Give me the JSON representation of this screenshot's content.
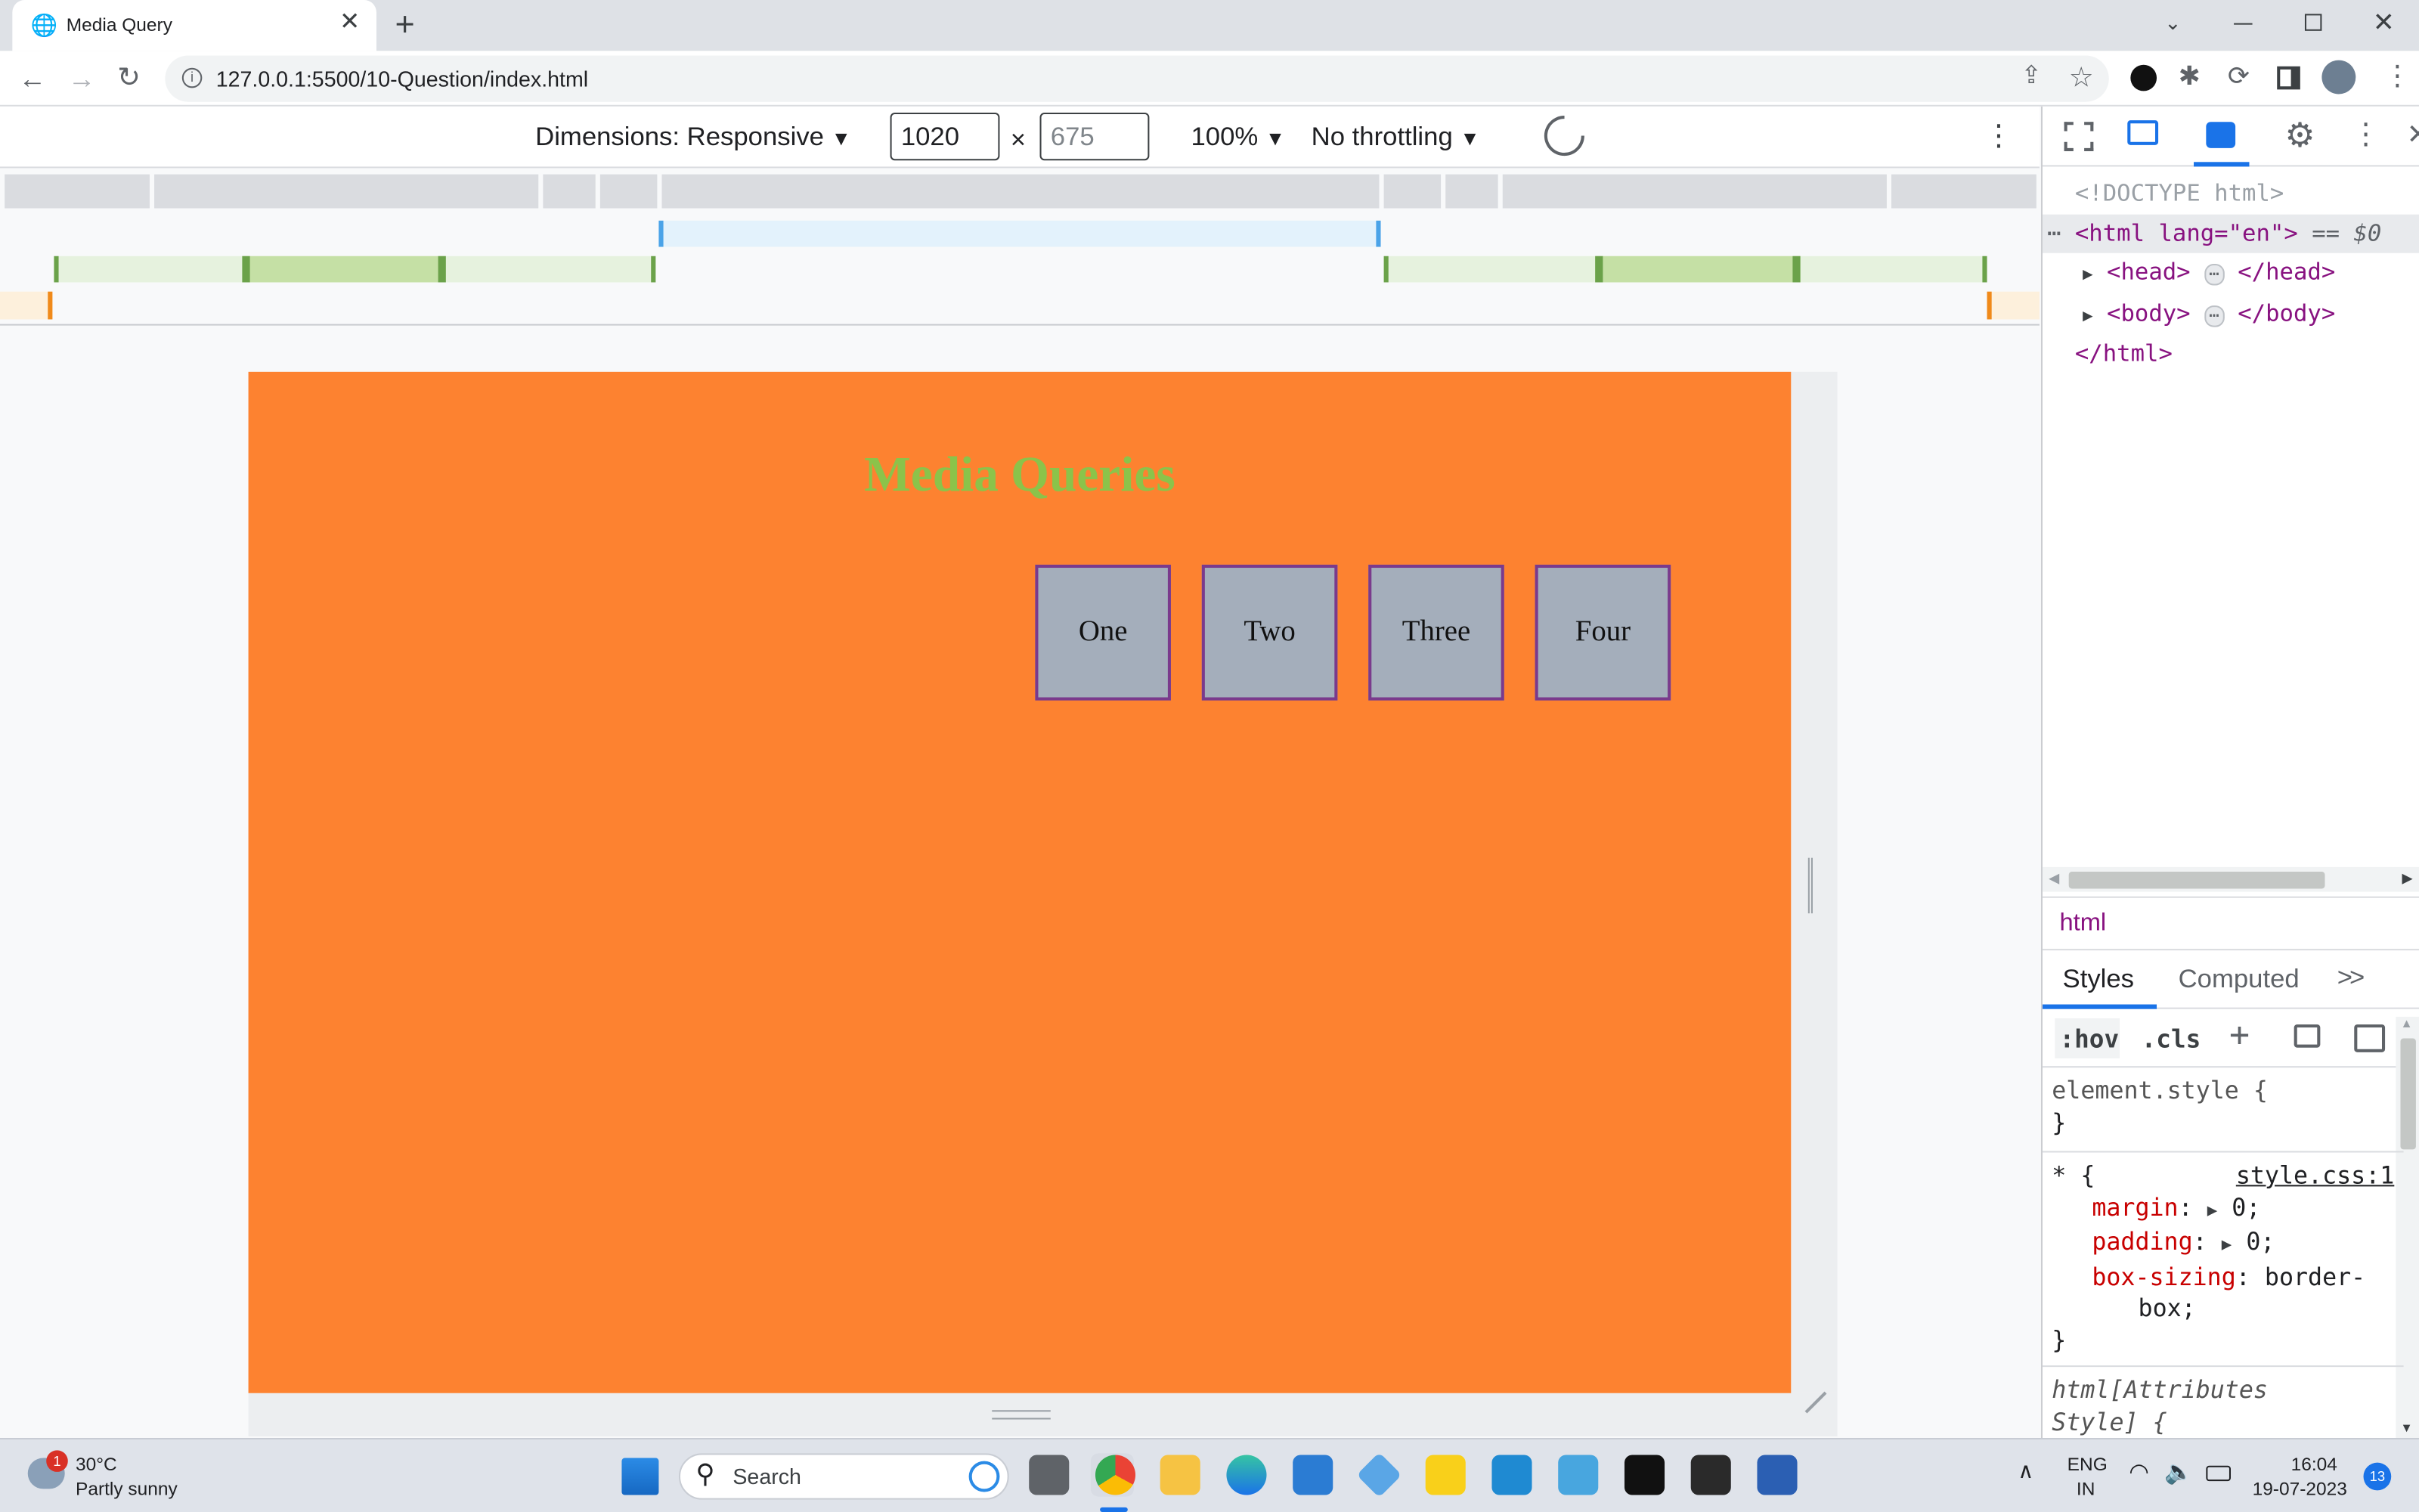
{
  "browser": {
    "tab_title": "Media Query",
    "url": "127.0.0.1:5500/10-Question/index.html"
  },
  "device_toolbar": {
    "dimensions_label": "Dimensions: Responsive",
    "width_value": "1020",
    "height_placeholder": "675",
    "times": "×",
    "zoom": "100%",
    "throttling": "No throttling"
  },
  "page": {
    "heading": "Media Queries",
    "boxes": [
      "One",
      "Two",
      "Three",
      "Four"
    ],
    "colors": {
      "background": "#fd8230",
      "heading": "#8bc34a",
      "box": "#a4aebb",
      "box_border": "#7a3a8c"
    }
  },
  "devtools": {
    "doctype": "<!DOCTYPE html>",
    "html_open": "<html lang=\"en\">",
    "eq_dollar": "== $0",
    "head_node_open": "<head>",
    "head_node_close": "</head>",
    "body_node_open": "<body>",
    "body_node_close": "</body>",
    "html_close": "</html>",
    "ellipsis": "⋯",
    "breadcrumb": "html",
    "tabs": [
      "Styles",
      "Computed"
    ],
    "more_tabs": ">>",
    "filters": [
      ":hov",
      ".cls"
    ],
    "element_style": "element.style {",
    "close_brace": "}",
    "rule_selector": "* {",
    "rule_source": "style.css:1",
    "props": [
      {
        "name": "margin",
        "value": "0;"
      },
      {
        "name": "padding",
        "value": "0;"
      },
      {
        "name": "box-sizing",
        "value": "border-"
      }
    ],
    "box_sizing_cont": "box;",
    "attr_style_1": "html[Attributes",
    "attr_style_2": "Style] {"
  },
  "taskbar": {
    "weather_temp": "30°C",
    "weather_desc": "Partly sunny",
    "weather_badge": "1",
    "search_label": "Search",
    "lang_top": "ENG",
    "lang_bottom": "IN",
    "time": "16:04",
    "date": "19-07-2023",
    "notif_count": "13"
  }
}
